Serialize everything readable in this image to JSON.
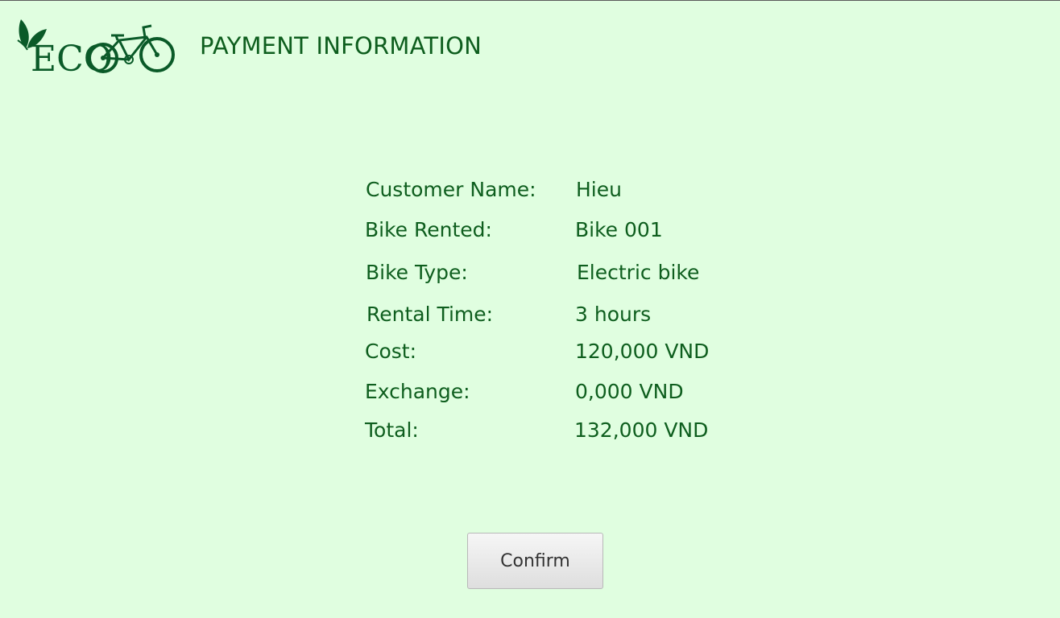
{
  "header": {
    "logo_text": "ECO",
    "title": "PAYMENT INFORMATION"
  },
  "payment": {
    "rows": [
      {
        "label": "Customer Name:",
        "value": "Hieu"
      },
      {
        "label": "Bike Rented:",
        "value": "Bike 001"
      },
      {
        "label": "Bike Type:",
        "value": "Electric bike"
      },
      {
        "label": "Rental Time:",
        "value": "3 hours"
      },
      {
        "label": "Cost:",
        "value": "120,000 VND"
      },
      {
        "label": "Exchange:",
        "value": "0,000 VND"
      },
      {
        "label": "Total:",
        "value": "132,000 VND"
      }
    ]
  },
  "actions": {
    "confirm_label": "Confirm"
  },
  "colors": {
    "background": "#e0fee0",
    "brand_green": "#0e5e1e",
    "logo_green": "#0a5a28"
  }
}
